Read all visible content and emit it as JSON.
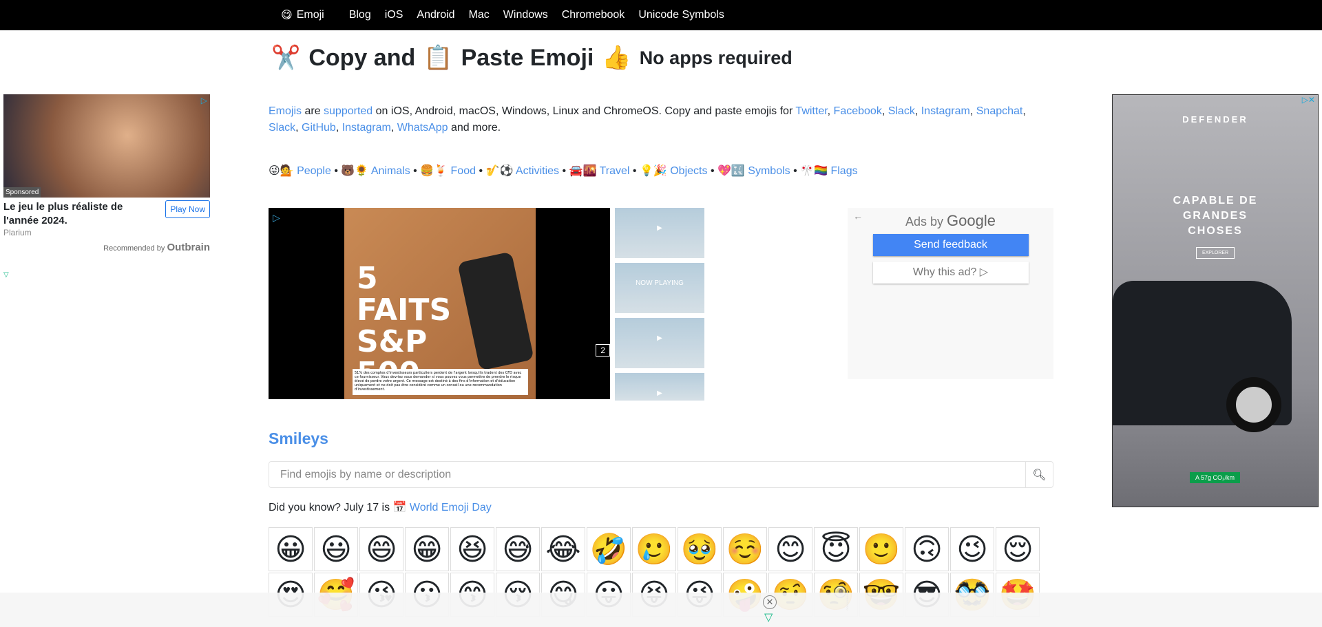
{
  "nav": {
    "brand_icon": "😋",
    "brand": "Emoji",
    "links": [
      "Blog",
      "iOS",
      "Android",
      "Mac",
      "Windows",
      "Chromebook",
      "Unicode Symbols"
    ]
  },
  "title": {
    "icon1": "✂️",
    "part1": "Copy and",
    "icon2": "📋",
    "part2": "Paste Emoji",
    "icon3": "👍",
    "sub": "No apps required"
  },
  "intro": {
    "l_emojis": "Emojis",
    "t1": " are ",
    "l_supported": "supported",
    "t2": " on iOS, Android, macOS, Windows, Linux and ChromeOS. Copy and paste emojis for ",
    "links": [
      "Twitter",
      "Facebook",
      "Slack",
      "Instagram",
      "Snapchat",
      "Slack",
      "GitHub",
      "Instagram",
      "WhatsApp"
    ],
    "t3": " and more."
  },
  "categories": [
    {
      "icons": "😜💁",
      "label": "People"
    },
    {
      "icons": "🐻🌻",
      "label": "Animals"
    },
    {
      "icons": "🍔🍹",
      "label": "Food"
    },
    {
      "icons": "🎷⚽",
      "label": "Activities"
    },
    {
      "icons": "🚘🌇",
      "label": "Travel"
    },
    {
      "icons": "💡🎉",
      "label": "Objects"
    },
    {
      "icons": "💖🔣",
      "label": "Symbols"
    },
    {
      "icons": "🎌🏳️‍🌈",
      "label": "Flags"
    }
  ],
  "video": {
    "headline": "5 FAITS S&P 500",
    "disclaimer": "51% des comptes d'investisseurs particuliers perdent de l'argent lorsqu'ils tradent des CFD avec ce fournisseur. Vous devriez vous demander si vous pouvez vous permettre de prendre le risque élevé de perdre votre argent. Ce message est destiné à des fins d'information et d'éducation uniquement et ne doit pas être considéré comme un conseil ou une recommandation d'investissement.",
    "count": "2",
    "now_playing": "NOW PLAYING"
  },
  "google_ad": {
    "ads_by": "Ads by",
    "google": "Google",
    "send_feedback": "Send feedback",
    "why": "Why this ad? ▷"
  },
  "section": {
    "title": "Smileys"
  },
  "search": {
    "placeholder": "Find emojis by name or description",
    "value": ""
  },
  "did_you_know": {
    "text": "Did you know? July 17 is",
    "icon": "📅",
    "link": "World Emoji Day"
  },
  "emojis": [
    [
      "😀",
      "😃",
      "😄",
      "😁",
      "😆",
      "😅",
      "😂",
      "🤣",
      "🥲",
      "🥹",
      "☺️",
      "😊",
      "😇",
      "🙂",
      "🙃",
      "😉",
      "😌"
    ],
    [
      "😍",
      "🥰",
      "😘",
      "😗",
      "😙",
      "😚",
      "😋",
      "😛",
      "😝",
      "😜",
      "🤪",
      "🤨",
      "🧐",
      "🤓",
      "😎",
      "🥸",
      "🤩"
    ]
  ],
  "left_ad": {
    "sponsored": "Sponsored",
    "title": "Le jeu le plus réaliste de l'année 2024.",
    "button": "Play Now",
    "advertiser": "Plarium",
    "recommended": "Recommended by",
    "network": "Outbrain"
  },
  "right_ad": {
    "brand": "DEFENDER",
    "headline": "CAPABLE DE GRANDES CHOSES",
    "cta": "EXPLORER",
    "co2": "A 57g CO₂/km"
  }
}
